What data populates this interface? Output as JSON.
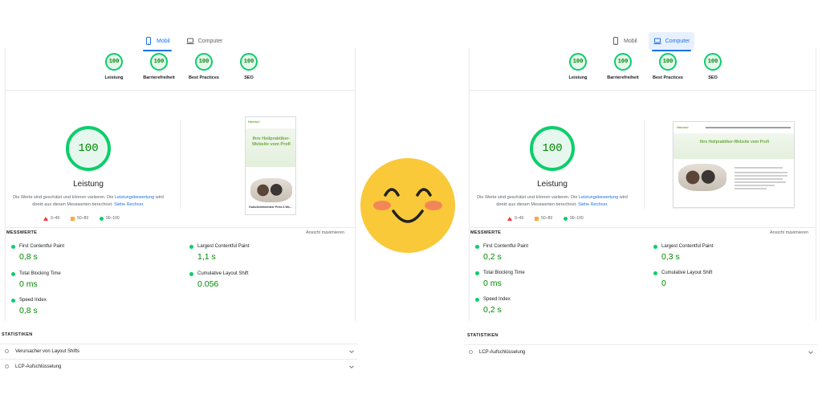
{
  "left": {
    "tabs": [
      {
        "label": "Mobil",
        "icon": "smartphone-icon",
        "active": true
      },
      {
        "label": "Computer",
        "icon": "laptop-icon",
        "active": false
      }
    ],
    "scores": [
      {
        "value": "100",
        "label": "Leistung"
      },
      {
        "value": "100",
        "label": "Barrierefreiheit"
      },
      {
        "value": "100",
        "label": "Best Practices"
      },
      {
        "value": "100",
        "label": "SEO"
      }
    ],
    "main_score": "100",
    "main_label": "Leistung",
    "desc_part1": "Die Werte sind geschätzt und können variieren. Die ",
    "desc_link1": "Leistungsbewertung",
    "desc_part2": " wird direkt aus diesen Messwerten berechnet. ",
    "desc_link2": "Siehe Rechner.",
    "legend": [
      "0–49",
      "50–89",
      "90–100"
    ],
    "metrics_title": "MESSWERTE",
    "expand_label": "Ansicht maximieren",
    "metrics": [
      {
        "name": "First Contentful Paint",
        "value": "0,8 s"
      },
      {
        "name": "Largest Contentful Paint",
        "value": "1,1 s"
      },
      {
        "name": "Total Blocking Time",
        "value": "0 ms"
      },
      {
        "name": "Cumulative Layout Shift",
        "value": "0.056"
      },
      {
        "name": "Speed Index",
        "value": "0,8 s"
      }
    ],
    "stats_title": "STATISTIKEN",
    "stats": [
      "Verursacher von Layout Shifts",
      "LCP-Aufschlüsselung"
    ],
    "preview": {
      "logo": "Himmel",
      "hero": "Ihre Heilpraktiker-Website vom Profi",
      "caption": "Gutscheinhöchster Preis 4 Wo..."
    }
  },
  "right": {
    "tabs": [
      {
        "label": "Mobil",
        "icon": "smartphone-icon",
        "active": false
      },
      {
        "label": "Computer",
        "icon": "laptop-icon",
        "active": true
      }
    ],
    "scores": [
      {
        "value": "100",
        "label": "Leistung"
      },
      {
        "value": "100",
        "label": "Barrierefreiheit"
      },
      {
        "value": "100",
        "label": "Best Practices"
      },
      {
        "value": "100",
        "label": "SEO"
      }
    ],
    "main_score": "100",
    "main_label": "Leistung",
    "desc_part1": "Die Werte sind geschätzt und können variieren. Die ",
    "desc_link1": "Leistungsbewertung",
    "desc_part2": " wird direkt aus diesen Messwerten berechnet. ",
    "desc_link2": "Siehe Rechner.",
    "legend": [
      "0–49",
      "50–89",
      "90–100"
    ],
    "metrics_title": "MESSWERTE",
    "expand_label": "Ansicht maximieren",
    "metrics": [
      {
        "name": "First Contentful Paint",
        "value": "0,2 s"
      },
      {
        "name": "Largest Contentful Paint",
        "value": "0,3 s"
      },
      {
        "name": "Total Blocking Time",
        "value": "0 ms"
      },
      {
        "name": "Cumulative Layout Shift",
        "value": "0"
      },
      {
        "name": "Speed Index",
        "value": "0,2 s"
      }
    ],
    "stats_title": "STATISTIKEN",
    "stats": [
      "LCP-Aufschlüsselung"
    ],
    "preview": {
      "logo": "Himmel",
      "hero": "Ihre Heilpraktiker-Website vom Profi"
    }
  },
  "colors": {
    "pass": "#0cce6b",
    "pass_text": "#008800",
    "accent": "#1a73e8",
    "emoji_face": "#f9c93a"
  },
  "emoji": "smiling-face-icon"
}
